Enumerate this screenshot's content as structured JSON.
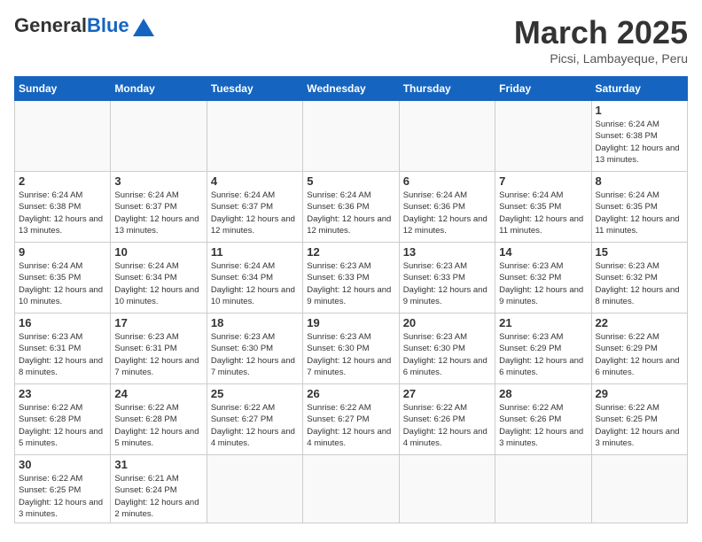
{
  "header": {
    "logo_general": "General",
    "logo_blue": "Blue",
    "month_title": "March 2025",
    "location": "Picsi, Lambayeque, Peru"
  },
  "weekdays": [
    "Sunday",
    "Monday",
    "Tuesday",
    "Wednesday",
    "Thursday",
    "Friday",
    "Saturday"
  ],
  "weeks": [
    [
      {
        "day": "",
        "info": ""
      },
      {
        "day": "",
        "info": ""
      },
      {
        "day": "",
        "info": ""
      },
      {
        "day": "",
        "info": ""
      },
      {
        "day": "",
        "info": ""
      },
      {
        "day": "",
        "info": ""
      },
      {
        "day": "1",
        "info": "Sunrise: 6:24 AM\nSunset: 6:38 PM\nDaylight: 12 hours and 13 minutes."
      }
    ],
    [
      {
        "day": "2",
        "info": "Sunrise: 6:24 AM\nSunset: 6:38 PM\nDaylight: 12 hours and 13 minutes."
      },
      {
        "day": "3",
        "info": "Sunrise: 6:24 AM\nSunset: 6:37 PM\nDaylight: 12 hours and 13 minutes."
      },
      {
        "day": "4",
        "info": "Sunrise: 6:24 AM\nSunset: 6:37 PM\nDaylight: 12 hours and 12 minutes."
      },
      {
        "day": "5",
        "info": "Sunrise: 6:24 AM\nSunset: 6:36 PM\nDaylight: 12 hours and 12 minutes."
      },
      {
        "day": "6",
        "info": "Sunrise: 6:24 AM\nSunset: 6:36 PM\nDaylight: 12 hours and 12 minutes."
      },
      {
        "day": "7",
        "info": "Sunrise: 6:24 AM\nSunset: 6:35 PM\nDaylight: 12 hours and 11 minutes."
      },
      {
        "day": "8",
        "info": "Sunrise: 6:24 AM\nSunset: 6:35 PM\nDaylight: 12 hours and 11 minutes."
      }
    ],
    [
      {
        "day": "9",
        "info": "Sunrise: 6:24 AM\nSunset: 6:35 PM\nDaylight: 12 hours and 10 minutes."
      },
      {
        "day": "10",
        "info": "Sunrise: 6:24 AM\nSunset: 6:34 PM\nDaylight: 12 hours and 10 minutes."
      },
      {
        "day": "11",
        "info": "Sunrise: 6:24 AM\nSunset: 6:34 PM\nDaylight: 12 hours and 10 minutes."
      },
      {
        "day": "12",
        "info": "Sunrise: 6:23 AM\nSunset: 6:33 PM\nDaylight: 12 hours and 9 minutes."
      },
      {
        "day": "13",
        "info": "Sunrise: 6:23 AM\nSunset: 6:33 PM\nDaylight: 12 hours and 9 minutes."
      },
      {
        "day": "14",
        "info": "Sunrise: 6:23 AM\nSunset: 6:32 PM\nDaylight: 12 hours and 9 minutes."
      },
      {
        "day": "15",
        "info": "Sunrise: 6:23 AM\nSunset: 6:32 PM\nDaylight: 12 hours and 8 minutes."
      }
    ],
    [
      {
        "day": "16",
        "info": "Sunrise: 6:23 AM\nSunset: 6:31 PM\nDaylight: 12 hours and 8 minutes."
      },
      {
        "day": "17",
        "info": "Sunrise: 6:23 AM\nSunset: 6:31 PM\nDaylight: 12 hours and 7 minutes."
      },
      {
        "day": "18",
        "info": "Sunrise: 6:23 AM\nSunset: 6:30 PM\nDaylight: 12 hours and 7 minutes."
      },
      {
        "day": "19",
        "info": "Sunrise: 6:23 AM\nSunset: 6:30 PM\nDaylight: 12 hours and 7 minutes."
      },
      {
        "day": "20",
        "info": "Sunrise: 6:23 AM\nSunset: 6:30 PM\nDaylight: 12 hours and 6 minutes."
      },
      {
        "day": "21",
        "info": "Sunrise: 6:23 AM\nSunset: 6:29 PM\nDaylight: 12 hours and 6 minutes."
      },
      {
        "day": "22",
        "info": "Sunrise: 6:22 AM\nSunset: 6:29 PM\nDaylight: 12 hours and 6 minutes."
      }
    ],
    [
      {
        "day": "23",
        "info": "Sunrise: 6:22 AM\nSunset: 6:28 PM\nDaylight: 12 hours and 5 minutes."
      },
      {
        "day": "24",
        "info": "Sunrise: 6:22 AM\nSunset: 6:28 PM\nDaylight: 12 hours and 5 minutes."
      },
      {
        "day": "25",
        "info": "Sunrise: 6:22 AM\nSunset: 6:27 PM\nDaylight: 12 hours and 4 minutes."
      },
      {
        "day": "26",
        "info": "Sunrise: 6:22 AM\nSunset: 6:27 PM\nDaylight: 12 hours and 4 minutes."
      },
      {
        "day": "27",
        "info": "Sunrise: 6:22 AM\nSunset: 6:26 PM\nDaylight: 12 hours and 4 minutes."
      },
      {
        "day": "28",
        "info": "Sunrise: 6:22 AM\nSunset: 6:26 PM\nDaylight: 12 hours and 3 minutes."
      },
      {
        "day": "29",
        "info": "Sunrise: 6:22 AM\nSunset: 6:25 PM\nDaylight: 12 hours and 3 minutes."
      }
    ],
    [
      {
        "day": "30",
        "info": "Sunrise: 6:22 AM\nSunset: 6:25 PM\nDaylight: 12 hours and 3 minutes."
      },
      {
        "day": "31",
        "info": "Sunrise: 6:21 AM\nSunset: 6:24 PM\nDaylight: 12 hours and 2 minutes."
      },
      {
        "day": "",
        "info": ""
      },
      {
        "day": "",
        "info": ""
      },
      {
        "day": "",
        "info": ""
      },
      {
        "day": "",
        "info": ""
      },
      {
        "day": "",
        "info": ""
      }
    ]
  ]
}
